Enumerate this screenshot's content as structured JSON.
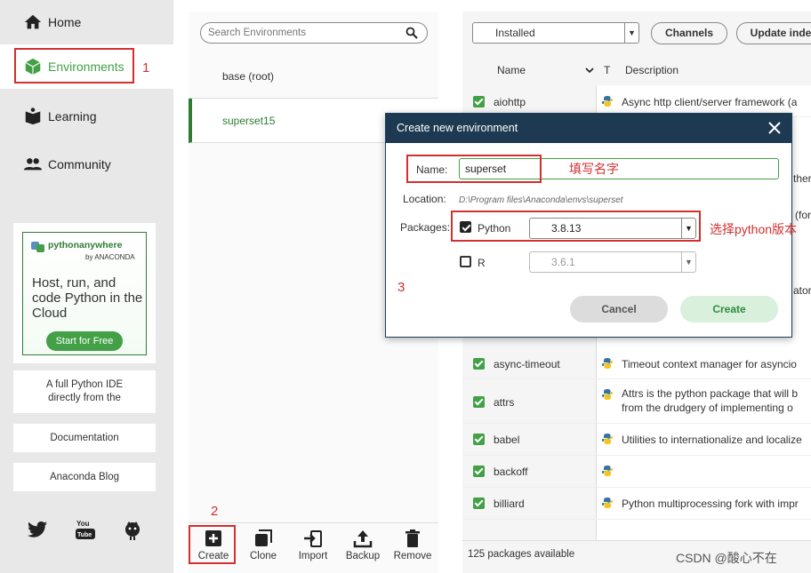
{
  "nav": {
    "items": [
      {
        "label": "Home",
        "icon": "home-icon"
      },
      {
        "label": "Environments",
        "icon": "cube-icon"
      },
      {
        "label": "Learning",
        "icon": "book-icon"
      },
      {
        "label": "Community",
        "icon": "people-icon"
      }
    ],
    "active": "Environments"
  },
  "promo": {
    "logo": "pythonanywhere",
    "by": "by ANACONDA",
    "tagline": "Host, run, and code Python in the Cloud",
    "button": "Start for Free"
  },
  "side_cards": [
    "A full Python IDE directly from the",
    "Documentation",
    "Anaconda Blog"
  ],
  "annotations": {
    "n1": "1",
    "n2": "2",
    "n3": "3",
    "fill_name": "填写名字",
    "choose_python": "选择python版本"
  },
  "env_panel": {
    "search_placeholder": "Search Environments",
    "environments": [
      {
        "name": "base (root)",
        "selected": false
      },
      {
        "name": "superset15",
        "selected": true
      }
    ],
    "toolbar": [
      "Create",
      "Clone",
      "Import",
      "Backup",
      "Remove"
    ]
  },
  "packages": {
    "filter": "Installed",
    "channels_label": "Channels",
    "update_label": "Update inde",
    "columns": {
      "name": "Name",
      "type": "T",
      "description": "Description"
    },
    "rows": [
      {
        "name": "aiohttp",
        "desc": [
          "Async http client/server framework (a"
        ]
      },
      {
        "name": "async-timeout",
        "desc": [
          "Timeout context manager for asyncio"
        ]
      },
      {
        "name": "attrs",
        "desc": [
          "Attrs is the python package that will b",
          "from the drudgery of implementing o"
        ]
      },
      {
        "name": "babel",
        "desc": [
          "Utilities to internationalize and localize"
        ]
      },
      {
        "name": "backoff",
        "desc": [
          ""
        ]
      },
      {
        "name": "billiard",
        "desc": [
          "Python multiprocessing fork with impr"
        ]
      }
    ],
    "hidden_fragments": [
      "ther",
      "(for",
      "ator"
    ],
    "status": "125 packages available"
  },
  "dialog": {
    "title": "Create new environment",
    "name_label": "Name:",
    "name_value": "superset",
    "location_label": "Location:",
    "location_value": "D:\\Program files\\Anaconda\\envs\\superset",
    "packages_label": "Packages:",
    "python_label": "Python",
    "python_version": "3.8.13",
    "r_label": "R",
    "r_version": "3.6.1",
    "cancel": "Cancel",
    "create": "Create"
  },
  "watermark": "CSDN @酸心不在",
  "colors": {
    "accent": "#43a047",
    "annotation": "#d32f2f",
    "dialog_title": "#1e3a52"
  }
}
